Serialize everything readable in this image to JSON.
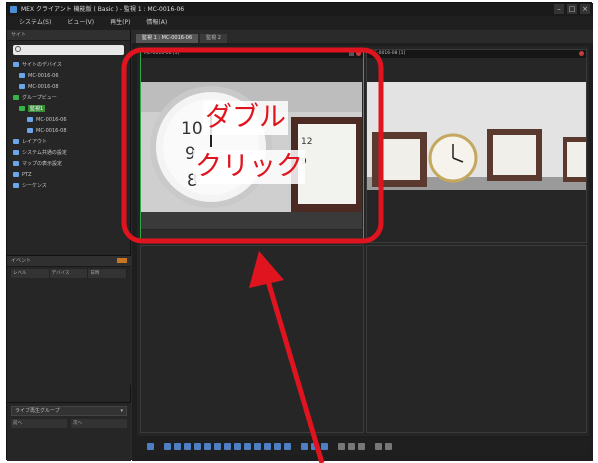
{
  "window": {
    "title": "MEX クライアント  機能版 ( Basic )  -  監視 1  :  MC-0016-06"
  },
  "menu": {
    "items": [
      "システム(S)",
      "ビュー(V)",
      "再生(P)",
      "情報(A)"
    ]
  },
  "sidebar": {
    "header": "サイト",
    "search_placeholder": "",
    "tree": [
      {
        "label": "サイトのデバイス",
        "level": 0,
        "icon": "server-icon"
      },
      {
        "label": "MC-0016-06",
        "level": 1,
        "icon": "camera-icon"
      },
      {
        "label": "MC-0016-08",
        "level": 1,
        "icon": "camera-icon"
      },
      {
        "label": "グループビュー",
        "level": 0,
        "icon": "group-icon"
      },
      {
        "label": "監視1",
        "level": 1,
        "icon": "view-icon",
        "selected": true
      },
      {
        "label": "MC-0016-06",
        "level": 2,
        "icon": "camera-icon"
      },
      {
        "label": "MC-0016-08",
        "level": 2,
        "icon": "camera-icon"
      },
      {
        "label": "レイアウト",
        "level": 0,
        "icon": "layout-icon"
      },
      {
        "label": "システム共通の設定",
        "level": 0,
        "icon": "settings-icon"
      },
      {
        "label": "マップの表示設定",
        "level": 0,
        "icon": "map-icon"
      },
      {
        "label": "PTZ",
        "level": 0,
        "icon": "ptz-icon"
      },
      {
        "label": "シーケンス",
        "level": 0,
        "icon": "sequence-icon"
      }
    ],
    "event_panel": {
      "header": "イベント",
      "columns": [
        "レベル",
        "デバイス",
        "日時"
      ]
    },
    "playback_panel": {
      "dropdown": "ライブ再生グループ",
      "left": "前へ",
      "right": "次へ"
    }
  },
  "tabs": [
    {
      "label": "監視 1 : MC-0016-06",
      "active": true
    },
    {
      "label": "監視 2",
      "active": false
    }
  ],
  "cells": [
    {
      "header": "MC-0016-06 [1]",
      "active": true
    },
    {
      "header": "MC-0016-08 [1]",
      "active": false
    },
    {
      "header": "",
      "active": false
    },
    {
      "header": "",
      "active": false
    }
  ],
  "annotation": {
    "line1": "ダブル",
    "line2": "クリック",
    "color": "#e0141e"
  },
  "colors": {
    "active_border": "#2fa84a",
    "selection": "#3b8f3b"
  }
}
